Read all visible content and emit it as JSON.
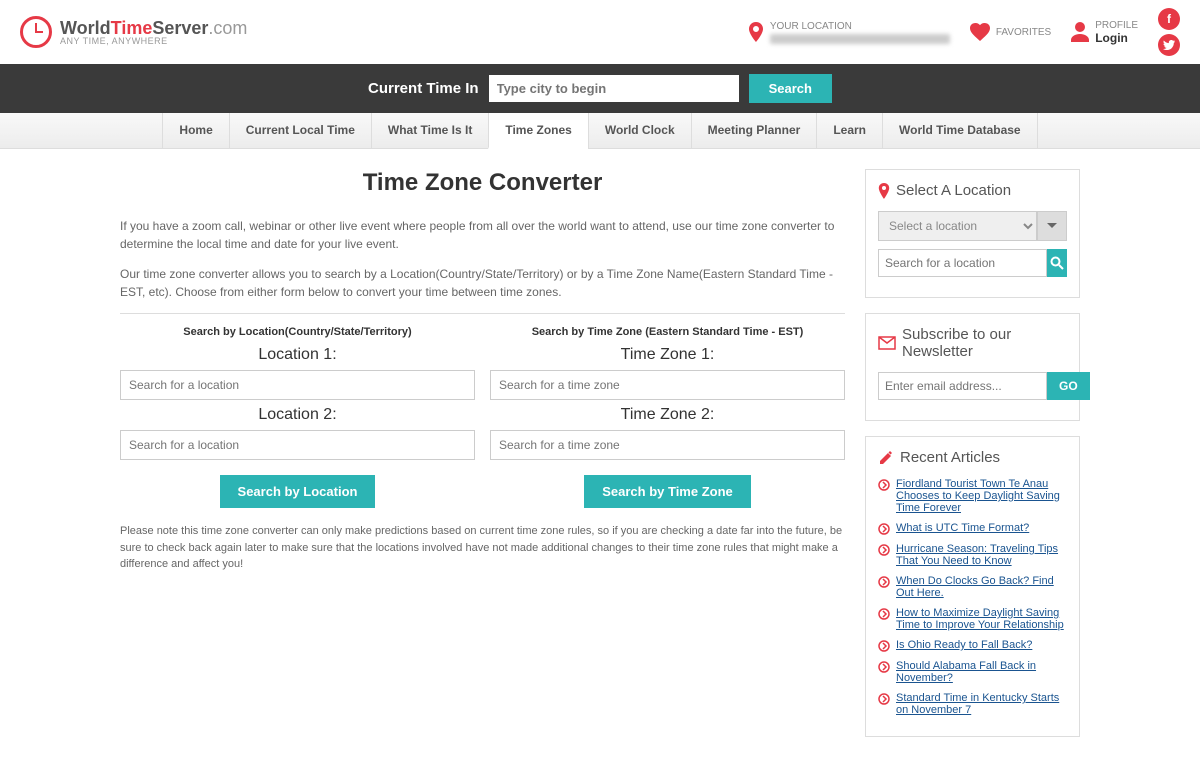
{
  "header": {
    "brand_world": "World",
    "brand_time": "Time",
    "brand_server": "Server",
    "brand_com": ".com",
    "tagline": "ANY TIME, ANYWHERE",
    "your_location": "YOUR LOCATION",
    "favorites": "FAVORITES",
    "profile": "PROFILE",
    "login": "Login"
  },
  "searchbar": {
    "label": "Current Time In",
    "placeholder": "Type city to begin",
    "button": "Search"
  },
  "nav": [
    "Home",
    "Current Local Time",
    "What Time Is It",
    "Time Zones",
    "World Clock",
    "Meeting Planner",
    "Learn",
    "World Time Database"
  ],
  "page": {
    "title": "Time Zone Converter",
    "intro1": "If you have a zoom call, webinar or other live event where people from all over the world want to attend, use our time zone converter to determine the local time and date for your live event.",
    "intro2": "Our time zone converter allows you to search by a Location(Country/State/Territory) or by a Time Zone Name(Eastern Standard Time - EST, etc). Choose from either form below to convert your time between time zones.",
    "note": "Please note this time zone converter can only make predictions based on current time zone rules, so if you are checking a date far into the future, be sure to check back again later to make sure that the locations involved have not made additional changes to their time zone rules that might make a difference and affect you!"
  },
  "formLoc": {
    "head": "Search by Location(Country/State/Territory)",
    "label1": "Location 1:",
    "label2": "Location 2:",
    "ph": "Search for a location",
    "btn": "Search by Location"
  },
  "formTz": {
    "head": "Search by Time Zone (Eastern Standard Time - EST)",
    "label1": "Time Zone 1:",
    "label2": "Time Zone 2:",
    "ph": "Search for a time zone",
    "btn": "Search by Time Zone"
  },
  "sideLoc": {
    "title": "Select A Location",
    "sel": "Select a location",
    "ph": "Search for a location"
  },
  "sideNews": {
    "title": "Subscribe to our Newsletter",
    "ph": "Enter email address...",
    "btn": "GO"
  },
  "sideArt": {
    "title": "Recent Articles",
    "items": [
      "Fiordland Tourist Town Te Anau Chooses to Keep Daylight Saving Time Forever",
      "What is UTC Time Format?",
      "Hurricane Season: Traveling Tips That You Need to Know",
      "When Do Clocks Go Back? Find Out Here.",
      "How to Maximize Daylight Saving Time to Improve Your Relationship",
      "Is Ohio Ready to Fall Back?",
      "Should Alabama Fall Back in November?",
      "Standard Time in Kentucky Starts on November 7"
    ]
  }
}
